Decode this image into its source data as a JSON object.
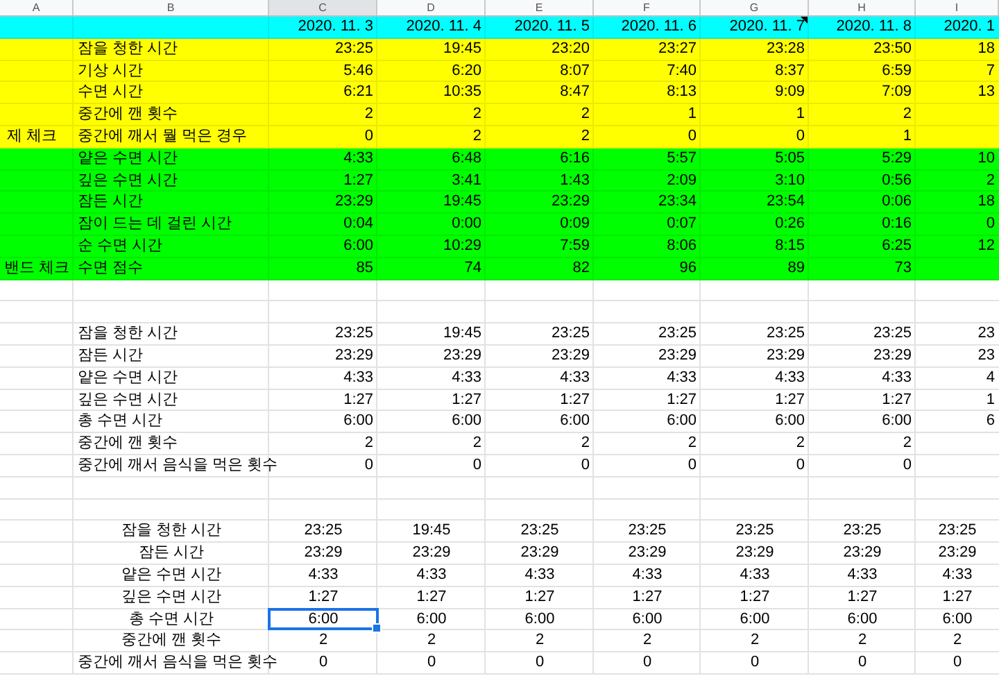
{
  "columns": [
    {
      "label": "A",
      "selected": false
    },
    {
      "label": "B",
      "selected": false
    },
    {
      "label": "C",
      "selected": true
    },
    {
      "label": "D",
      "selected": false
    },
    {
      "label": "E",
      "selected": false
    },
    {
      "label": "F",
      "selected": false
    },
    {
      "label": "G",
      "selected": false
    },
    {
      "label": "H",
      "selected": false
    },
    {
      "label": "I",
      "selected": false
    }
  ],
  "date_row": {
    "color": "#00ffff",
    "dates": [
      {
        "text": "2020. 11. 3",
        "note": false
      },
      {
        "text": "2020. 11. 4",
        "note": false
      },
      {
        "text": "2020. 11. 5",
        "note": false
      },
      {
        "text": "2020. 11. 6",
        "note": false
      },
      {
        "text": "2020. 11. 7",
        "note": true
      },
      {
        "text": "2020. 11. 8",
        "note": false
      },
      {
        "text": "2020. 1",
        "note": false
      }
    ]
  },
  "sections": [
    {
      "kind": "colored",
      "color": "#ffff00",
      "group_label": "제 체크",
      "rows": [
        {
          "label": "잠을 청한 시간",
          "values": [
            "23:25",
            "19:45",
            "23:20",
            "23:27",
            "23:28",
            "23:50",
            "18"
          ]
        },
        {
          "label": "기상 시간",
          "values": [
            "5:46",
            "6:20",
            "8:07",
            "7:40",
            "8:37",
            "6:59",
            "7"
          ]
        },
        {
          "label": "수면 시간",
          "values": [
            "6:21",
            "10:35",
            "8:47",
            "8:13",
            "9:09",
            "7:09",
            "13"
          ]
        },
        {
          "label": "중간에 깬 횟수",
          "values": [
            "2",
            "2",
            "2",
            "1",
            "1",
            "2"
          ]
        },
        {
          "label": "중간에 깨서 뭘 먹은 경우",
          "values": [
            "0",
            "2",
            "2",
            "0",
            "0",
            "1"
          ]
        }
      ]
    },
    {
      "kind": "colored",
      "color": "#00ff00",
      "group_label": "밴드 체크",
      "rows": [
        {
          "label": "얕은 수면 시간",
          "values": [
            "4:33",
            "6:48",
            "6:16",
            "5:57",
            "5:05",
            "5:29",
            "10"
          ]
        },
        {
          "label": "깊은 수면 시간",
          "values": [
            "1:27",
            "3:41",
            "1:43",
            "2:09",
            "3:10",
            "0:56",
            "2"
          ]
        },
        {
          "label": "잠든 시간",
          "values": [
            "23:29",
            "19:45",
            "23:29",
            "23:34",
            "23:54",
            "0:06",
            "18"
          ]
        },
        {
          "label": "잠이 드는 데 걸린 시간",
          "values": [
            "0:04",
            "0:00",
            "0:09",
            "0:07",
            "0:26",
            "0:16",
            "0"
          ]
        },
        {
          "label": "순 수면 시간",
          "values": [
            "6:00",
            "10:29",
            "7:59",
            "8:06",
            "8:15",
            "6:25",
            "12"
          ]
        },
        {
          "label": "수면 점수",
          "values": [
            "85",
            "74",
            "82",
            "96",
            "89",
            "73"
          ]
        }
      ]
    },
    {
      "kind": "plain",
      "rows": [
        {
          "label": "잠을 청한 시간",
          "values": [
            "23:25",
            "19:45",
            "23:25",
            "23:25",
            "23:25",
            "23:25",
            "23"
          ]
        },
        {
          "label": "잠든 시간",
          "values": [
            "23:29",
            "23:29",
            "23:29",
            "23:29",
            "23:29",
            "23:29",
            "23"
          ]
        },
        {
          "label": "얕은 수면 시간",
          "values": [
            "4:33",
            "4:33",
            "4:33",
            "4:33",
            "4:33",
            "4:33",
            "4"
          ]
        },
        {
          "label": "깊은 수면 시간",
          "values": [
            "1:27",
            "1:27",
            "1:27",
            "1:27",
            "1:27",
            "1:27",
            "1"
          ]
        },
        {
          "label": "총 수면 시간",
          "values": [
            "6:00",
            "6:00",
            "6:00",
            "6:00",
            "6:00",
            "6:00",
            "6"
          ]
        },
        {
          "label": "중간에 깬 횟수",
          "values": [
            "2",
            "2",
            "2",
            "2",
            "2",
            "2"
          ]
        },
        {
          "label": "중간에 깨서 음식을 먹은 횟수",
          "values": [
            "0",
            "0",
            "0",
            "0",
            "0",
            "0"
          ]
        }
      ]
    },
    {
      "kind": "centered",
      "rows": [
        {
          "label": "잠을 청한 시간",
          "selected": false,
          "values": [
            "23:25",
            "19:45",
            "23:25",
            "23:25",
            "23:25",
            "23:25",
            "23:25"
          ]
        },
        {
          "label": "잠든 시간",
          "selected": false,
          "values": [
            "23:29",
            "23:29",
            "23:29",
            "23:29",
            "23:29",
            "23:29",
            "23:29"
          ]
        },
        {
          "label": "얕은 수면 시간",
          "selected": false,
          "values": [
            "4:33",
            "4:33",
            "4:33",
            "4:33",
            "4:33",
            "4:33",
            "4:33"
          ]
        },
        {
          "label": "깊은 수면 시간",
          "selected": false,
          "values": [
            "1:27",
            "1:27",
            "1:27",
            "1:27",
            "1:27",
            "1:27",
            "1:27"
          ]
        },
        {
          "label": "총 수면 시간",
          "selected": true,
          "values": [
            "6:00",
            "6:00",
            "6:00",
            "6:00",
            "6:00",
            "6:00",
            "6:00"
          ]
        },
        {
          "label": "중간에 깬 횟수",
          "selected": false,
          "values": [
            "2",
            "2",
            "2",
            "2",
            "2",
            "2",
            "2"
          ]
        },
        {
          "label": "중간에 깨서 음식을 먹은 횟수",
          "selected": false,
          "values": [
            "0",
            "0",
            "0",
            "0",
            "0",
            "0",
            "0"
          ]
        }
      ]
    }
  ]
}
